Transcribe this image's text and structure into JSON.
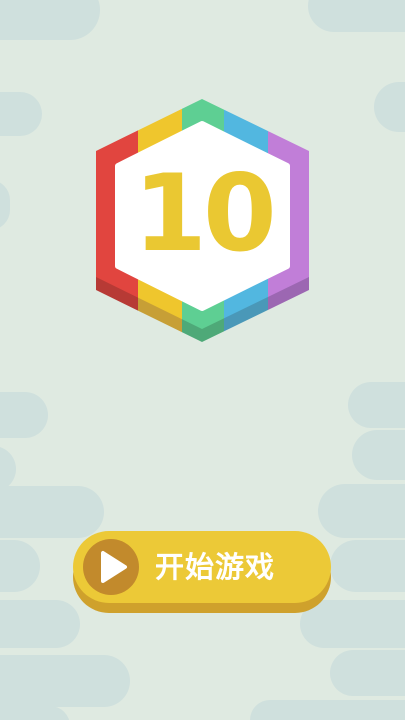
{
  "logo": {
    "number": "10",
    "number_color": "#eac832",
    "segment_colors": [
      "#e1453f",
      "#efc62d",
      "#5ecf93",
      "#52b7e0",
      "#c17ed8"
    ]
  },
  "start_button": {
    "label": "开始游戏",
    "icon": "play-icon",
    "face_color": "#ecc937",
    "icon_bg_color": "#c28a2c"
  },
  "theme": {
    "background": "#dfeae1",
    "cloud_color": "#cfe0dd"
  }
}
